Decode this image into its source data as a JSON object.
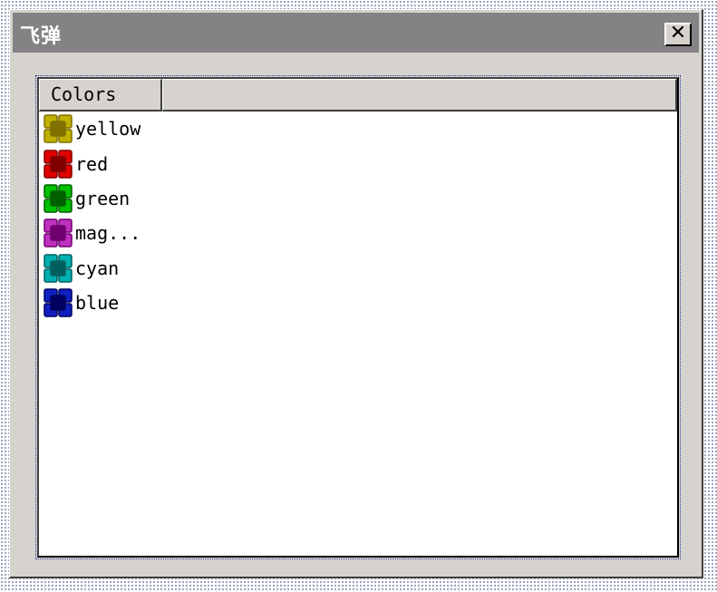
{
  "dialog": {
    "title": "飞弹",
    "close_label": "✕"
  },
  "listview": {
    "column_headers": [
      "Colors",
      ""
    ],
    "items": [
      {
        "label": "yellow",
        "color": "#c0b000",
        "dark": "#807000"
      },
      {
        "label": "red",
        "color": "#e00000",
        "dark": "#800000"
      },
      {
        "label": "green",
        "color": "#00c000",
        "dark": "#006000"
      },
      {
        "label": "mag...",
        "color": "#c030c0",
        "dark": "#700070"
      },
      {
        "label": "cyan",
        "color": "#00b0b0",
        "dark": "#006060"
      },
      {
        "label": "blue",
        "color": "#1020c0",
        "dark": "#000060"
      }
    ],
    "item_icon": "color-swatch-icon"
  }
}
